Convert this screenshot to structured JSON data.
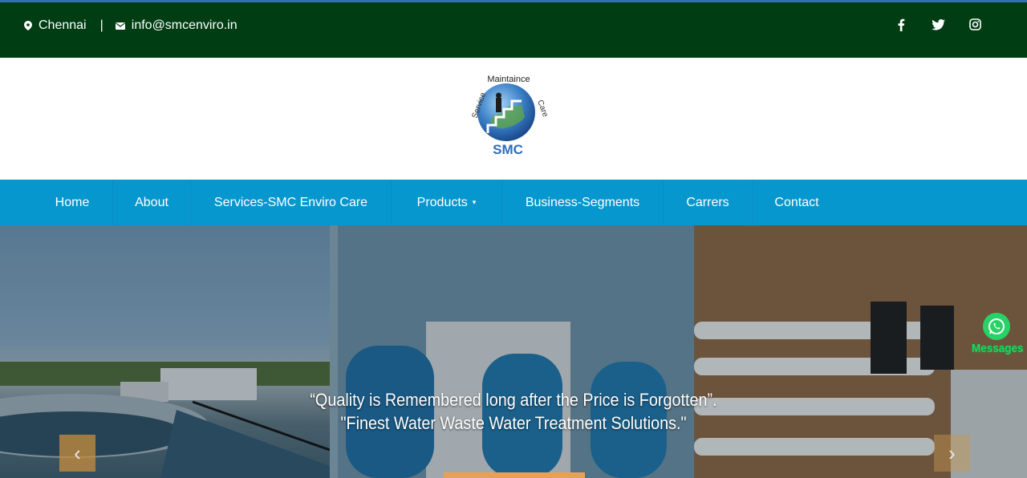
{
  "topbar": {
    "location": "Chennai",
    "separator": "|",
    "email": "info@smcenviro.in",
    "social": [
      "f",
      "twitter",
      "instagram"
    ]
  },
  "logo": {
    "top_text": "Maintaince",
    "left_text": "Service",
    "right_text": "Care",
    "brand": "SMC"
  },
  "nav": {
    "items": [
      {
        "label": "Home"
      },
      {
        "label": "About"
      },
      {
        "label": "Services-SMC Enviro Care"
      },
      {
        "label": "Products"
      },
      {
        "label": "Business-Segments"
      },
      {
        "label": "Carrers"
      },
      {
        "label": "Contact"
      }
    ],
    "products_caret": "▾"
  },
  "hero": {
    "quote_line1": "“Quality is Remembered long after the Price is Forgotten”.",
    "quote_line2": "\"Finest Water Waste Water Treatment Solutions.\"",
    "prev": "‹",
    "next": "›"
  },
  "whatsapp": {
    "label": "Messages"
  },
  "colors": {
    "topbar_bg": "#003d13",
    "nav_bg": "#0797cf",
    "accent": "#e8a154",
    "whatsapp": "#25d366"
  }
}
